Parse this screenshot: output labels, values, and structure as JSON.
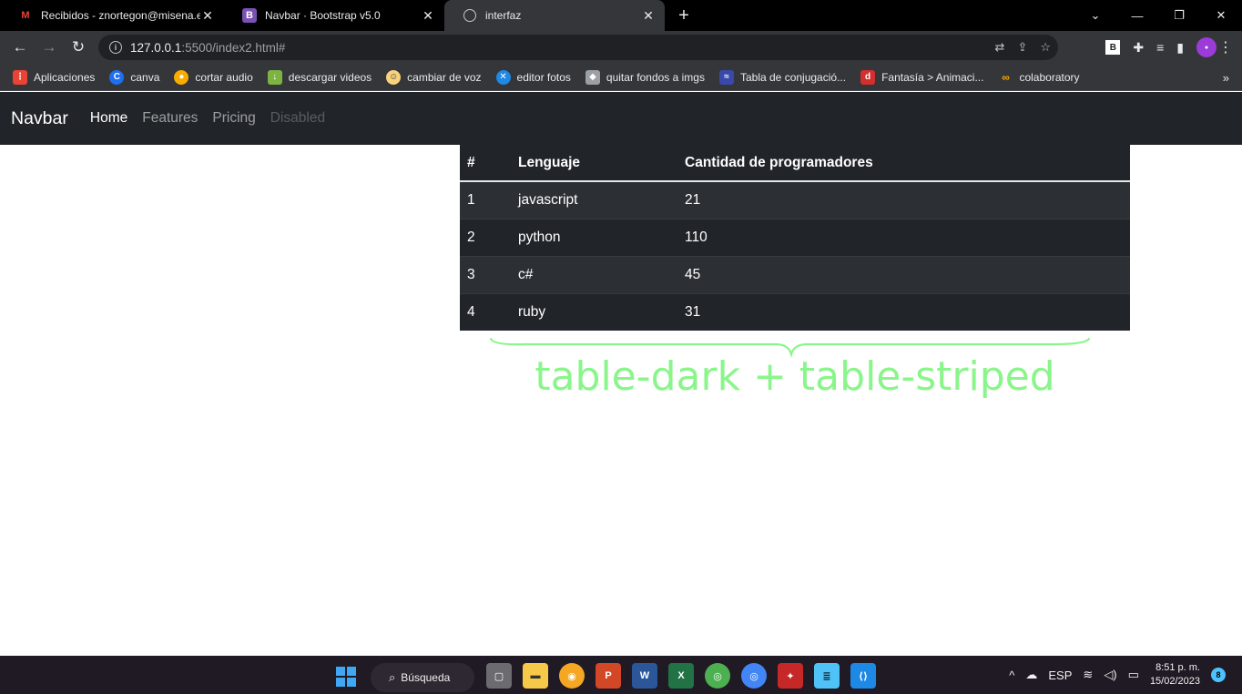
{
  "browser": {
    "tabs": [
      {
        "title": "Recibidos - znortegon@misena.e",
        "icon": "gmail-icon",
        "active": false
      },
      {
        "title": "Navbar · Bootstrap v5.0",
        "icon": "bootstrap-icon",
        "active": false
      },
      {
        "title": "interfaz",
        "icon": "globe-icon",
        "active": true
      }
    ],
    "url_host": "127.0.0.1",
    "url_path": ":5500/index2.html#",
    "bookmarks": [
      {
        "label": "Aplicaciones",
        "icon": "apps-grid-icon",
        "color": "#e8eaed"
      },
      {
        "label": "canva",
        "icon": "canva-icon",
        "color": "#00c4cc"
      },
      {
        "label": "cortar audio",
        "icon": "audio-icon",
        "color": "#4285f4"
      },
      {
        "label": "descargar videos",
        "icon": "download-icon",
        "color": "#7cb342"
      },
      {
        "label": "cambiar de voz",
        "icon": "voice-icon",
        "color": "#f9d27e"
      },
      {
        "label": "editor fotos",
        "icon": "photo-editor-icon",
        "color": "#1e88e5"
      },
      {
        "label": "quitar fondos  a imgs",
        "icon": "layers-icon",
        "color": "#9aa0a6"
      },
      {
        "label": "Tabla de conjugació...",
        "icon": "table-conj-icon",
        "color": "#3949ab"
      },
      {
        "label": "Fantasía > Animaci...",
        "icon": "fantasy-icon",
        "color": "#d32f2f"
      },
      {
        "label": "colaboratory",
        "icon": "colab-icon",
        "color": "#f9ab00"
      }
    ]
  },
  "navbar": {
    "brand": "Navbar",
    "links": [
      {
        "label": "Home",
        "state": "active"
      },
      {
        "label": "Features",
        "state": "normal"
      },
      {
        "label": "Pricing",
        "state": "normal"
      },
      {
        "label": "Disabled",
        "state": "disabled"
      }
    ]
  },
  "table": {
    "headers": [
      "#",
      "Lenguaje",
      "Cantidad de programadores"
    ],
    "rows": [
      [
        "1",
        "javascript",
        "21"
      ],
      [
        "2",
        "python",
        "110"
      ],
      [
        "3",
        "c#",
        "45"
      ],
      [
        "4",
        "ruby",
        "31"
      ]
    ]
  },
  "annotation": {
    "text": "table-dark + table-striped",
    "color": "#8af58a"
  },
  "taskbar": {
    "search_label": "Búsqueda",
    "language": "ESP",
    "time": "8:51 p. m.",
    "date": "15/02/2023",
    "notifications": "8"
  }
}
